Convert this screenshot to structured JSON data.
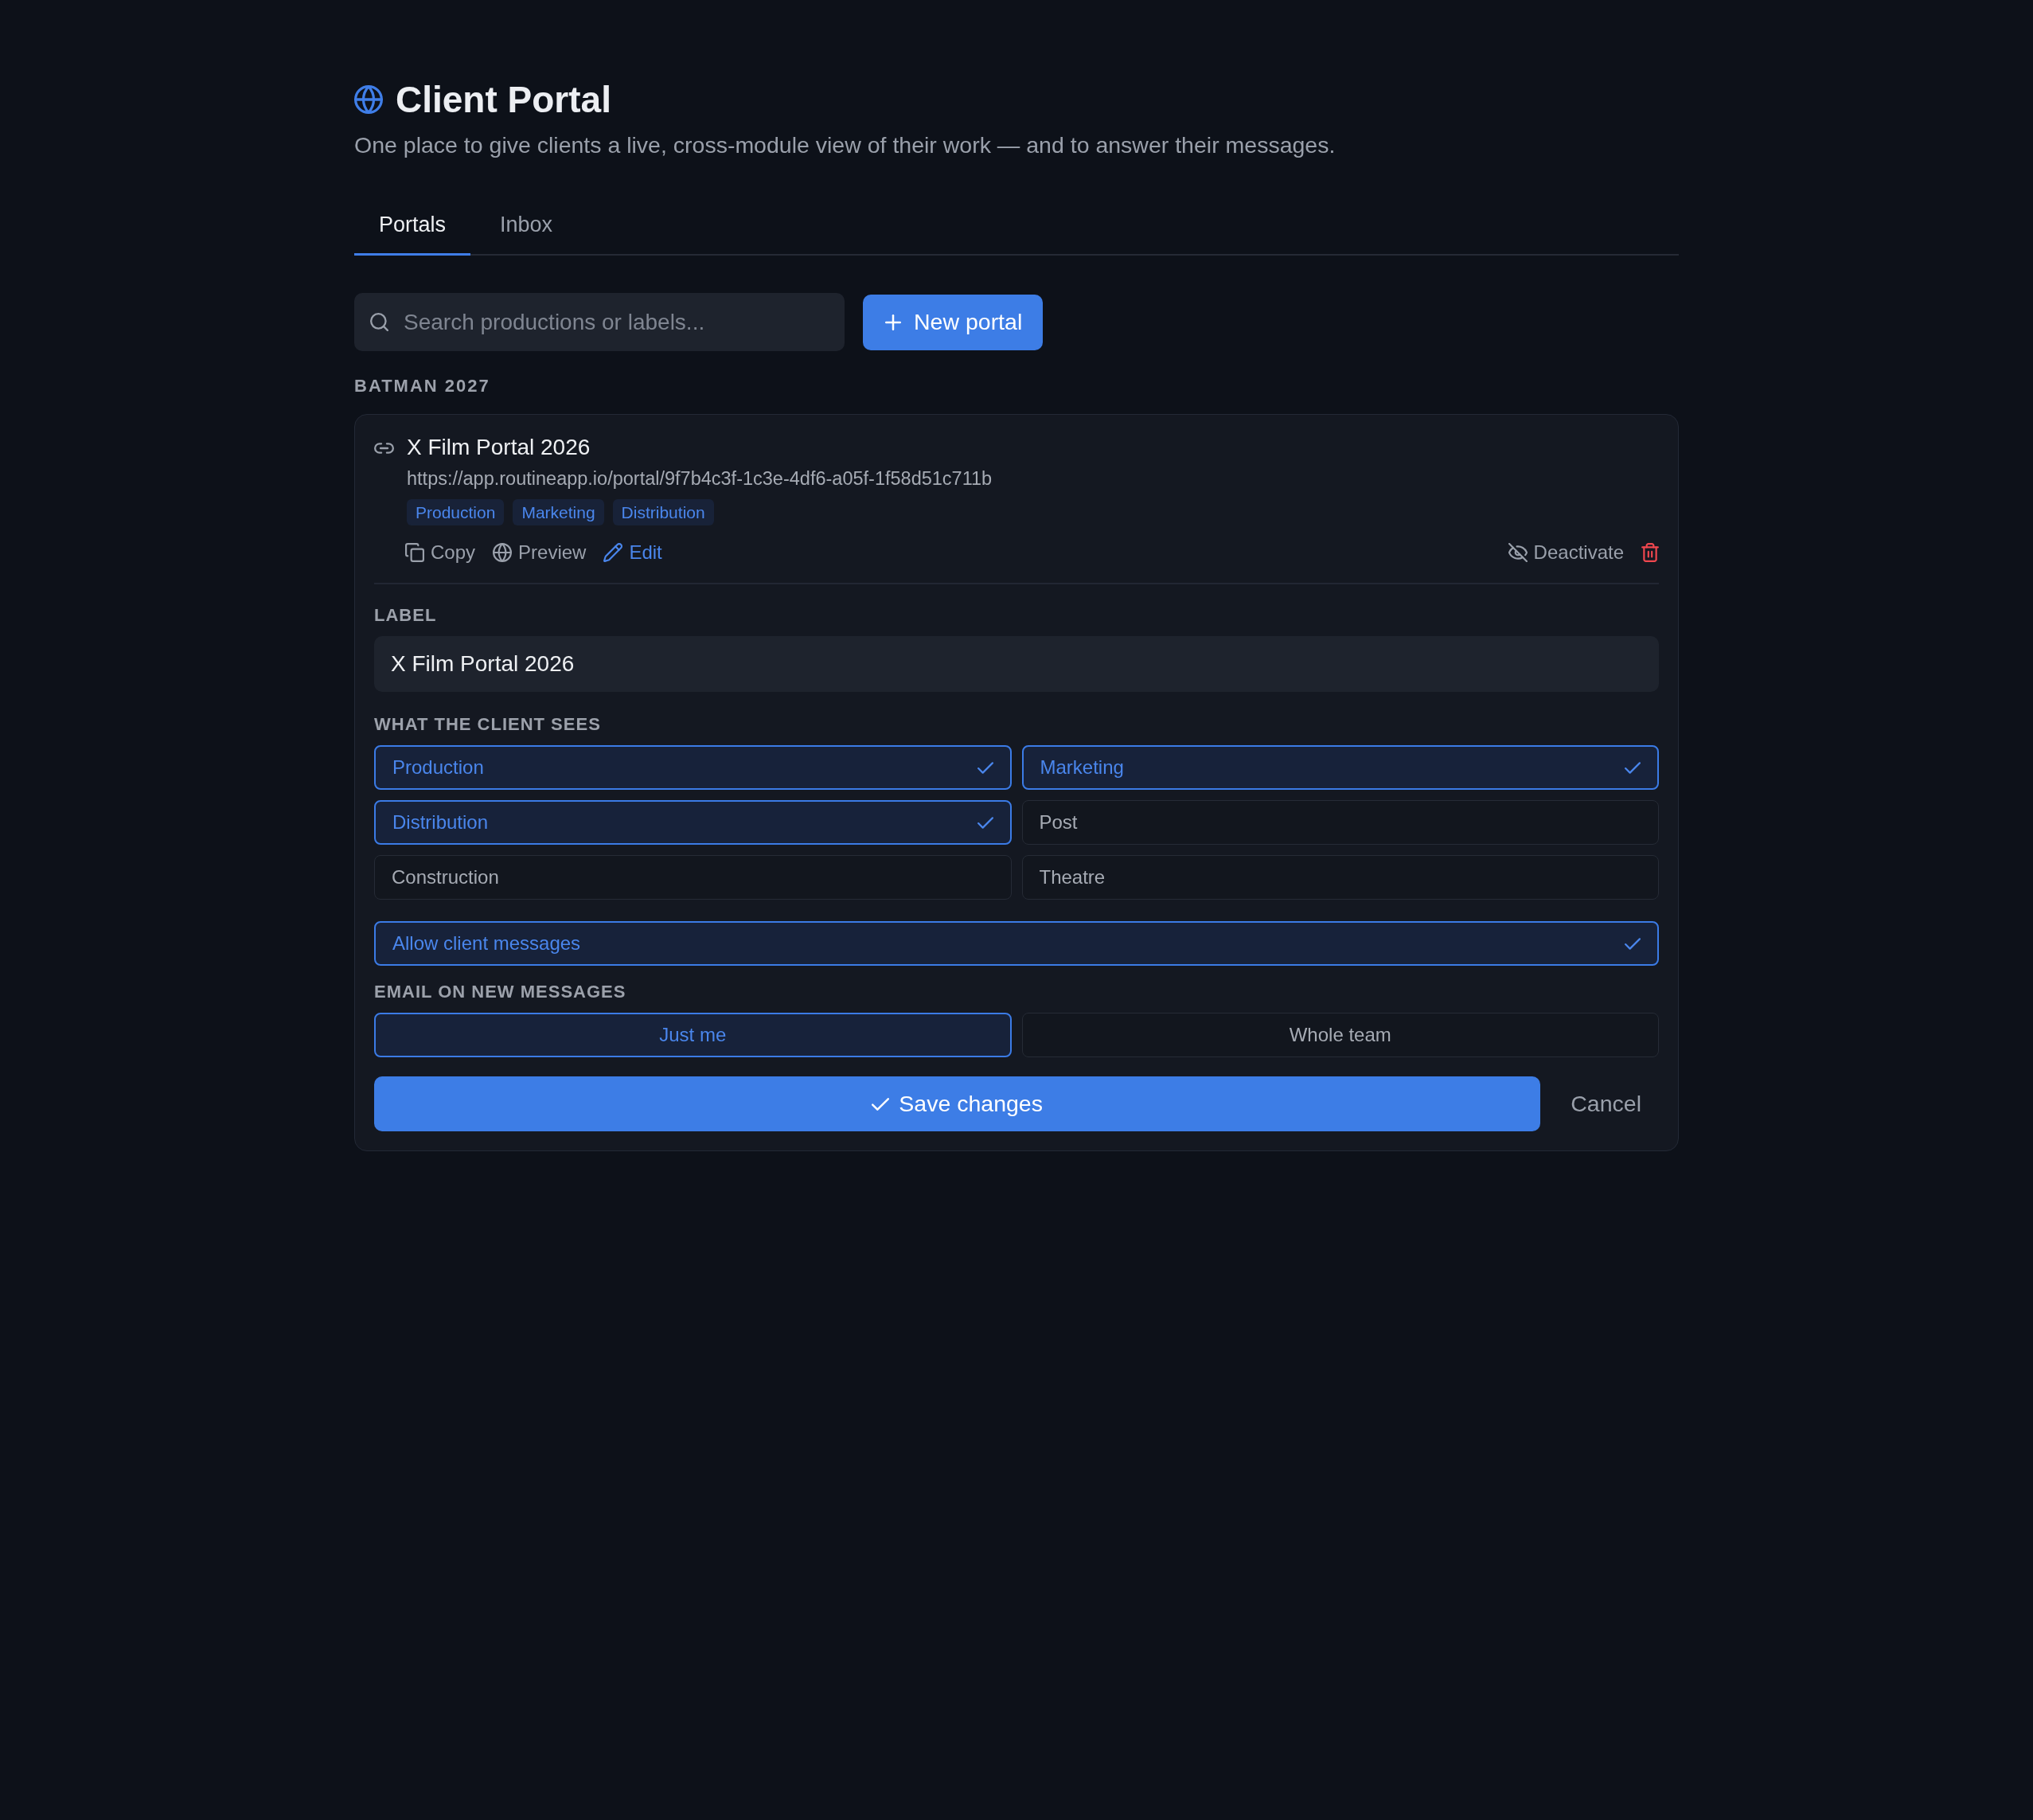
{
  "header": {
    "title": "Client Portal",
    "subtitle": "One place to give clients a live, cross-module view of their work — and to answer their messages."
  },
  "tabs": [
    {
      "label": "Portals",
      "selected": true
    },
    {
      "label": "Inbox",
      "selected": false
    }
  ],
  "search": {
    "placeholder": "Search productions or labels..."
  },
  "new_button": {
    "label": "New portal"
  },
  "production": {
    "heading": "BATMAN 2027",
    "portal": {
      "name": "X Film Portal 2026",
      "url": "https://app.routineapp.io/portal/9f7b4c3f-1c3e-4df6-a05f-1f58d51c711b",
      "tags": [
        "Production",
        "Marketing",
        "Distribution"
      ],
      "actions": [
        {
          "kind": "copy",
          "label": "Copy",
          "active": false
        },
        {
          "kind": "preview",
          "label": "Preview",
          "active": false
        },
        {
          "kind": "edit",
          "label": "Edit",
          "active": true
        }
      ],
      "deactivate": {
        "label": "Deactivate"
      },
      "editor": {
        "label_heading": "LABEL",
        "label_value": "X Film Portal 2026",
        "modules_heading": "WHAT THE CLIENT SEES",
        "modules": [
          {
            "label": "Production",
            "checked": true
          },
          {
            "label": "Marketing",
            "checked": true
          },
          {
            "label": "Distribution",
            "checked": true
          },
          {
            "label": "Post",
            "checked": false
          },
          {
            "label": "Construction",
            "checked": false
          },
          {
            "label": "Theatre",
            "checked": false
          }
        ],
        "allow_messages": {
          "label": "Allow client messages",
          "checked": true
        },
        "email_heading": "EMAIL ON NEW MESSAGES",
        "email_options": [
          {
            "label": "Just me",
            "selected": true
          },
          {
            "label": "Whole team",
            "selected": false
          }
        ],
        "save": {
          "label": "Save changes"
        },
        "cancel": {
          "label": "Cancel"
        }
      }
    }
  }
}
